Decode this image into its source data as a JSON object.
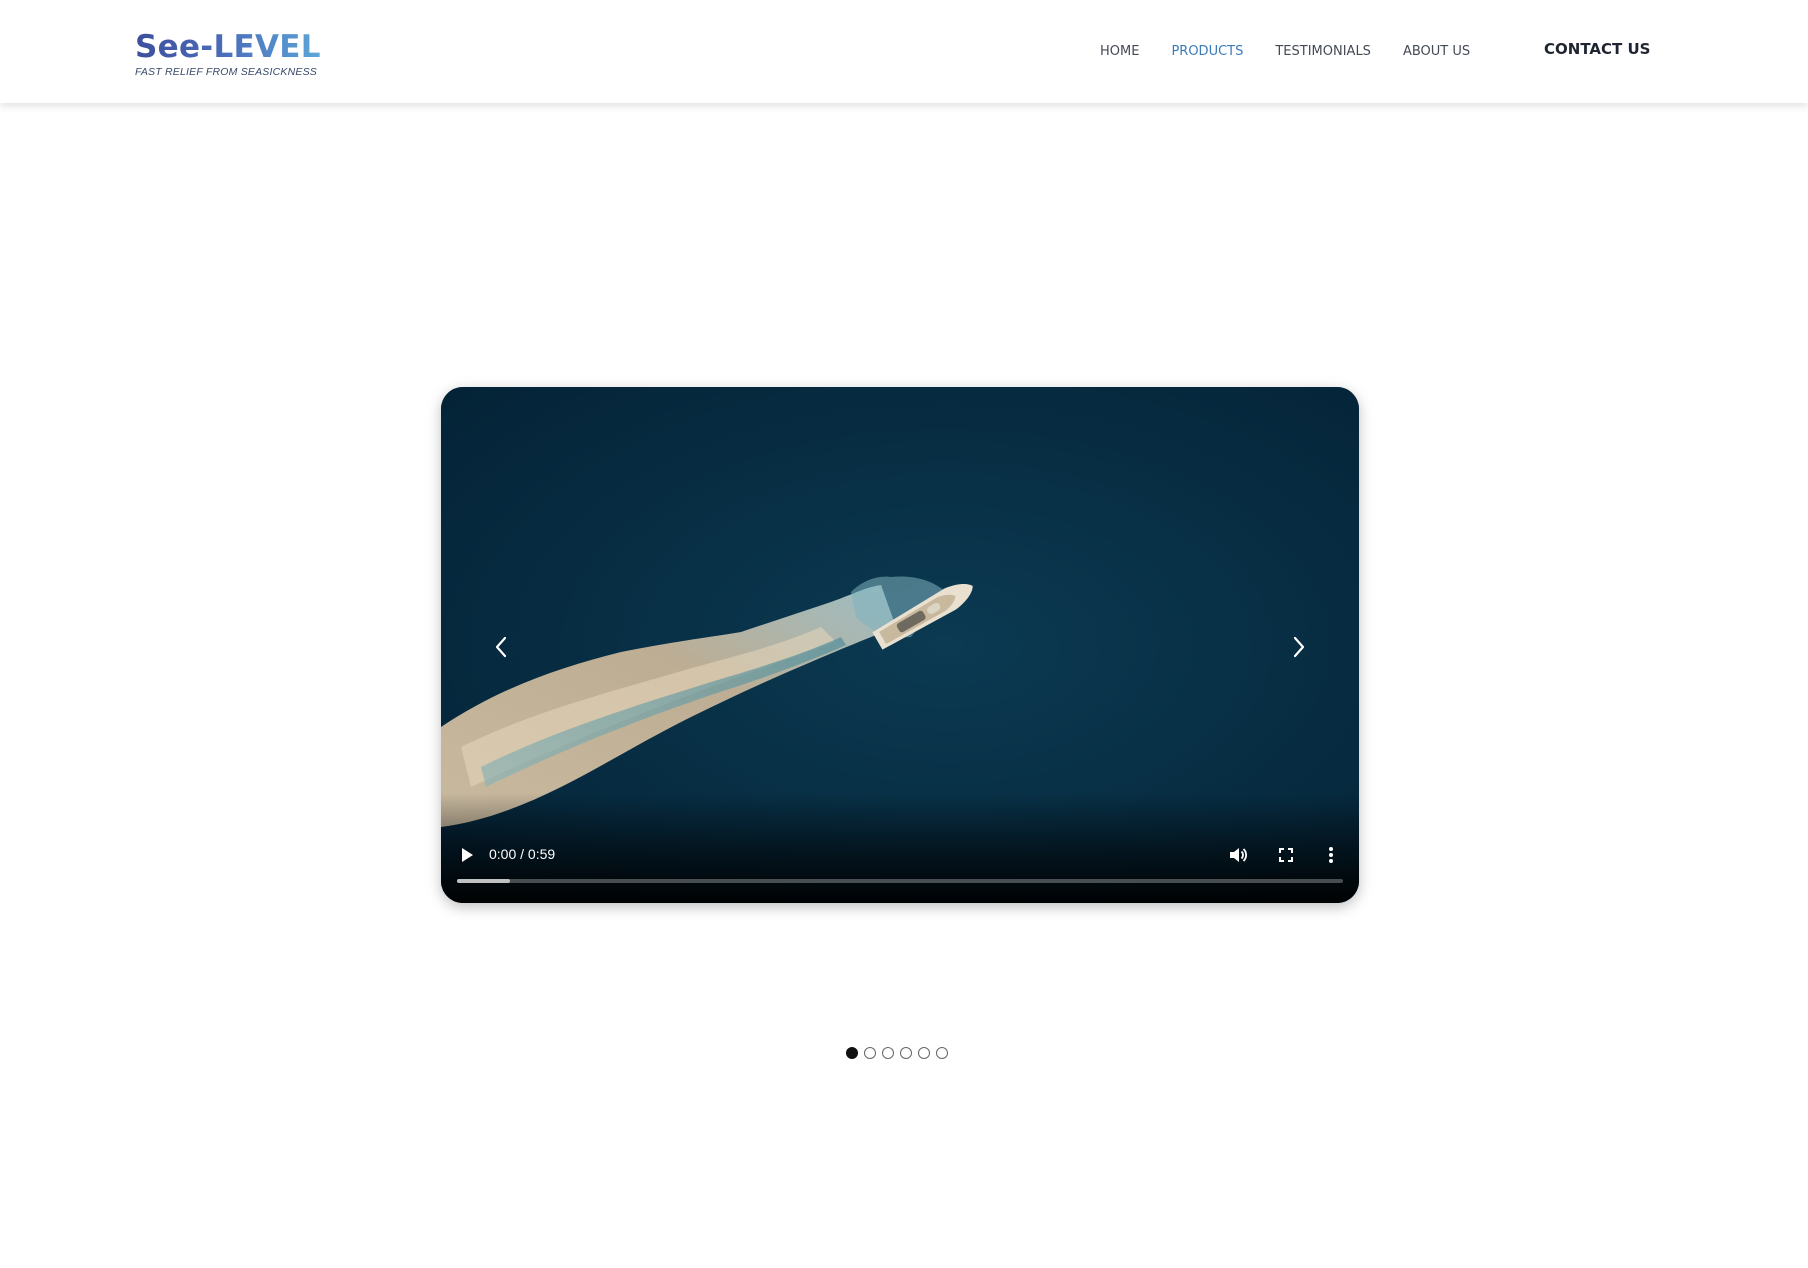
{
  "header": {
    "logo": {
      "title": "See-LEVEL",
      "tagline": "FAST RELIEF FROM SEASICKNESS"
    },
    "nav": [
      {
        "label": "HOME",
        "active": false
      },
      {
        "label": "PRODUCTS",
        "active": true
      },
      {
        "label": "TESTIMONIALS",
        "active": false
      },
      {
        "label": "ABOUT US",
        "active": false
      }
    ],
    "contact_label": "CONTACT US"
  },
  "carousel": {
    "prev_icon": "chevron-left-icon",
    "next_icon": "chevron-right-icon",
    "video": {
      "subject": "aerial view of a white motor yacht with wake on dark blue sea",
      "time_display": "0:00 / 0:59",
      "buffered_fraction": 0.06,
      "icons": {
        "play": "play-icon",
        "volume": "volume-icon",
        "fullscreen": "fullscreen-icon",
        "more": "more-options-icon"
      }
    },
    "slides_count": 6,
    "active_slide": 0
  },
  "colors": {
    "accent": "#3a7bb8",
    "logo_gradient_start": "#3d4f9c",
    "logo_gradient_end": "#5ba6d8",
    "sea": "#062a3e"
  }
}
